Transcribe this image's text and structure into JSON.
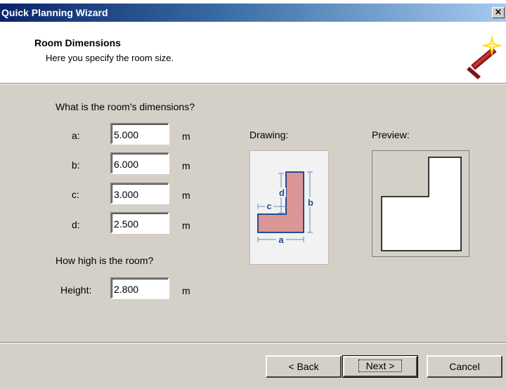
{
  "window": {
    "title": "Quick Planning Wizard",
    "close_glyph": "×"
  },
  "header": {
    "title": "Room Dimensions",
    "subtitle": "Here you specify the room size.",
    "icon": "magic-wand-icon"
  },
  "dimensions": {
    "question": "What is the room's dimensions?",
    "fields": [
      {
        "label": "a:",
        "value": "5.000",
        "unit": "m"
      },
      {
        "label": "b:",
        "value": "6.000",
        "unit": "m"
      },
      {
        "label": "c:",
        "value": "3.000",
        "unit": "m"
      },
      {
        "label": "d:",
        "value": "2.500",
        "unit": "m"
      }
    ]
  },
  "height": {
    "question": "How high is the room?",
    "label": "Height:",
    "value": "2.800",
    "unit": "m"
  },
  "drawing": {
    "label": "Drawing:",
    "dim_labels": {
      "a": "a",
      "b": "b",
      "c": "c",
      "d": "d"
    }
  },
  "preview": {
    "label": "Preview:"
  },
  "buttons": {
    "back": "< Back",
    "next": "Next >",
    "cancel": "Cancel"
  },
  "colors": {
    "title_start": "#0a246a",
    "title_end": "#a6caf0",
    "dialog_bg": "#d4d0c8",
    "dim_blue": "#1e4e9a",
    "room_fill": "#e7a3a3"
  }
}
